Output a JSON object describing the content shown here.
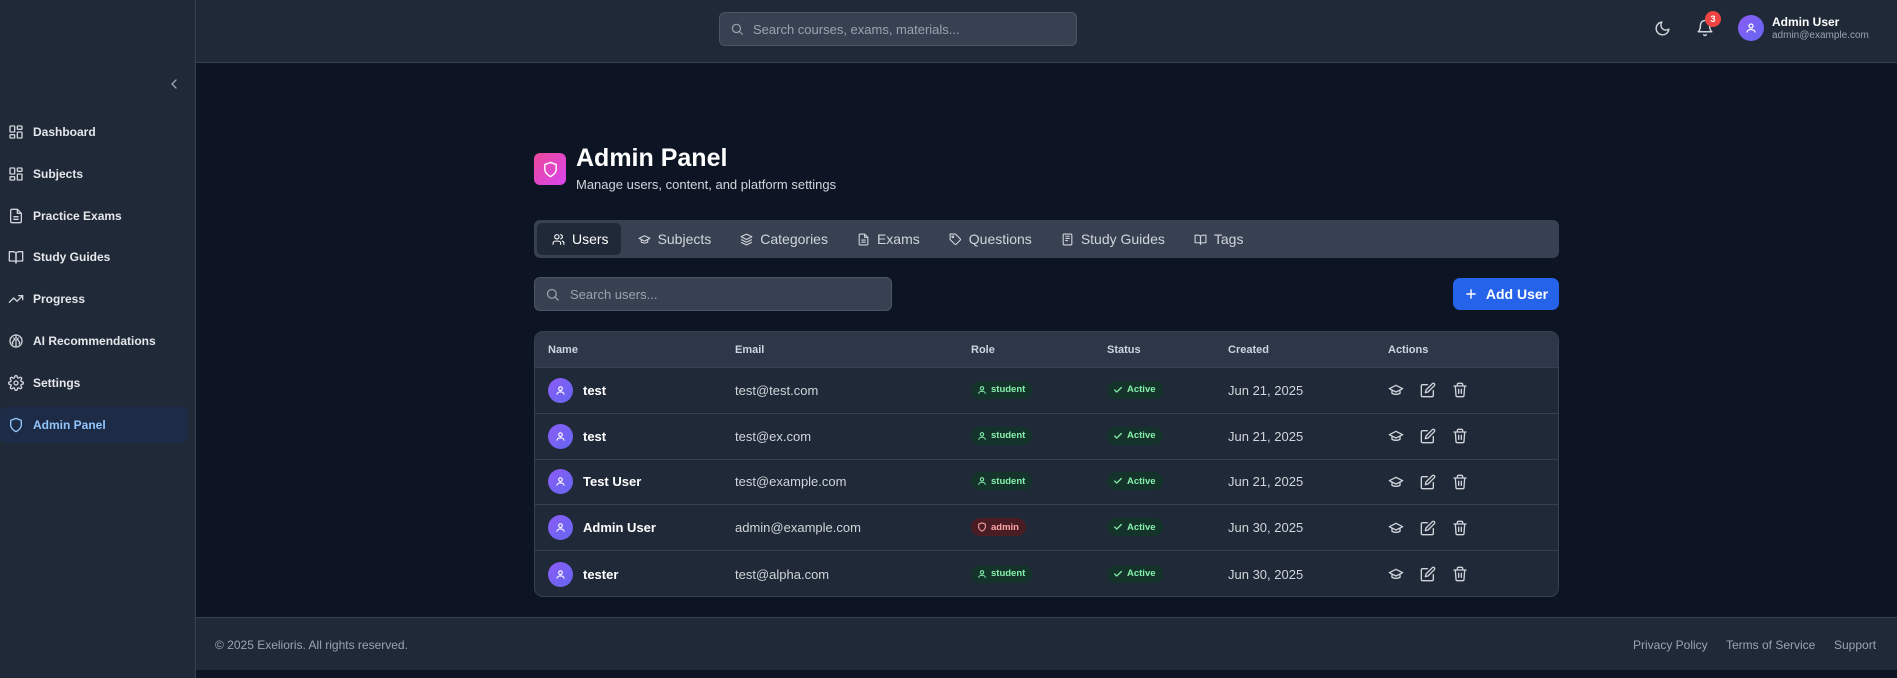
{
  "sidebar": {
    "items": [
      {
        "label": "Dashboard",
        "icon": "dashboard-icon"
      },
      {
        "label": "Subjects",
        "icon": "grid-icon"
      },
      {
        "label": "Practice Exams",
        "icon": "document-icon"
      },
      {
        "label": "Study Guides",
        "icon": "book-icon"
      },
      {
        "label": "Progress",
        "icon": "trending-up-icon"
      },
      {
        "label": "AI Recommendations",
        "icon": "brain-icon"
      },
      {
        "label": "Settings",
        "icon": "gear-icon"
      },
      {
        "label": "Admin Panel",
        "icon": "shield-icon"
      }
    ]
  },
  "header": {
    "search_placeholder": "Search courses, exams, materials...",
    "notification_count": "3",
    "user_name": "Admin User",
    "user_email": "admin@example.com"
  },
  "page": {
    "title": "Admin Panel",
    "subtitle": "Manage users, content, and platform settings"
  },
  "tabs": [
    {
      "label": "Users",
      "icon": "users-icon"
    },
    {
      "label": "Subjects",
      "icon": "graduation-cap-icon"
    },
    {
      "label": "Categories",
      "icon": "layers-icon"
    },
    {
      "label": "Exams",
      "icon": "document-icon"
    },
    {
      "label": "Questions",
      "icon": "tag-icon"
    },
    {
      "label": "Study Guides",
      "icon": "notebook-icon"
    },
    {
      "label": "Tags",
      "icon": "book-open-icon"
    }
  ],
  "users_toolbar": {
    "search_placeholder": "Search users...",
    "add_label": "Add User"
  },
  "table": {
    "headers": [
      "Name",
      "Email",
      "Role",
      "Status",
      "Created",
      "Actions"
    ],
    "rows": [
      {
        "name": "test",
        "email": "test@test.com",
        "role": "student",
        "status": "Active",
        "created": "Jun 21, 2025"
      },
      {
        "name": "test",
        "email": "test@ex.com",
        "role": "student",
        "status": "Active",
        "created": "Jun 21, 2025"
      },
      {
        "name": "Test User",
        "email": "test@example.com",
        "role": "student",
        "status": "Active",
        "created": "Jun 21, 2025"
      },
      {
        "name": "Admin User",
        "email": "admin@example.com",
        "role": "admin",
        "status": "Active",
        "created": "Jun 30, 2025"
      },
      {
        "name": "tester",
        "email": "test@alpha.com",
        "role": "student",
        "status": "Active",
        "created": "Jun 30, 2025"
      }
    ]
  },
  "footer": {
    "copyright": "© 2025 Exelioris. All rights reserved.",
    "links": [
      "Privacy Policy",
      "Terms of Service",
      "Support"
    ]
  },
  "colors": {
    "background": "#0d1525",
    "panel": "#1f2937",
    "accent": "#2563eb",
    "active_nav": "#93c5fd",
    "success": "#86efac",
    "danger": "#ef4444"
  }
}
